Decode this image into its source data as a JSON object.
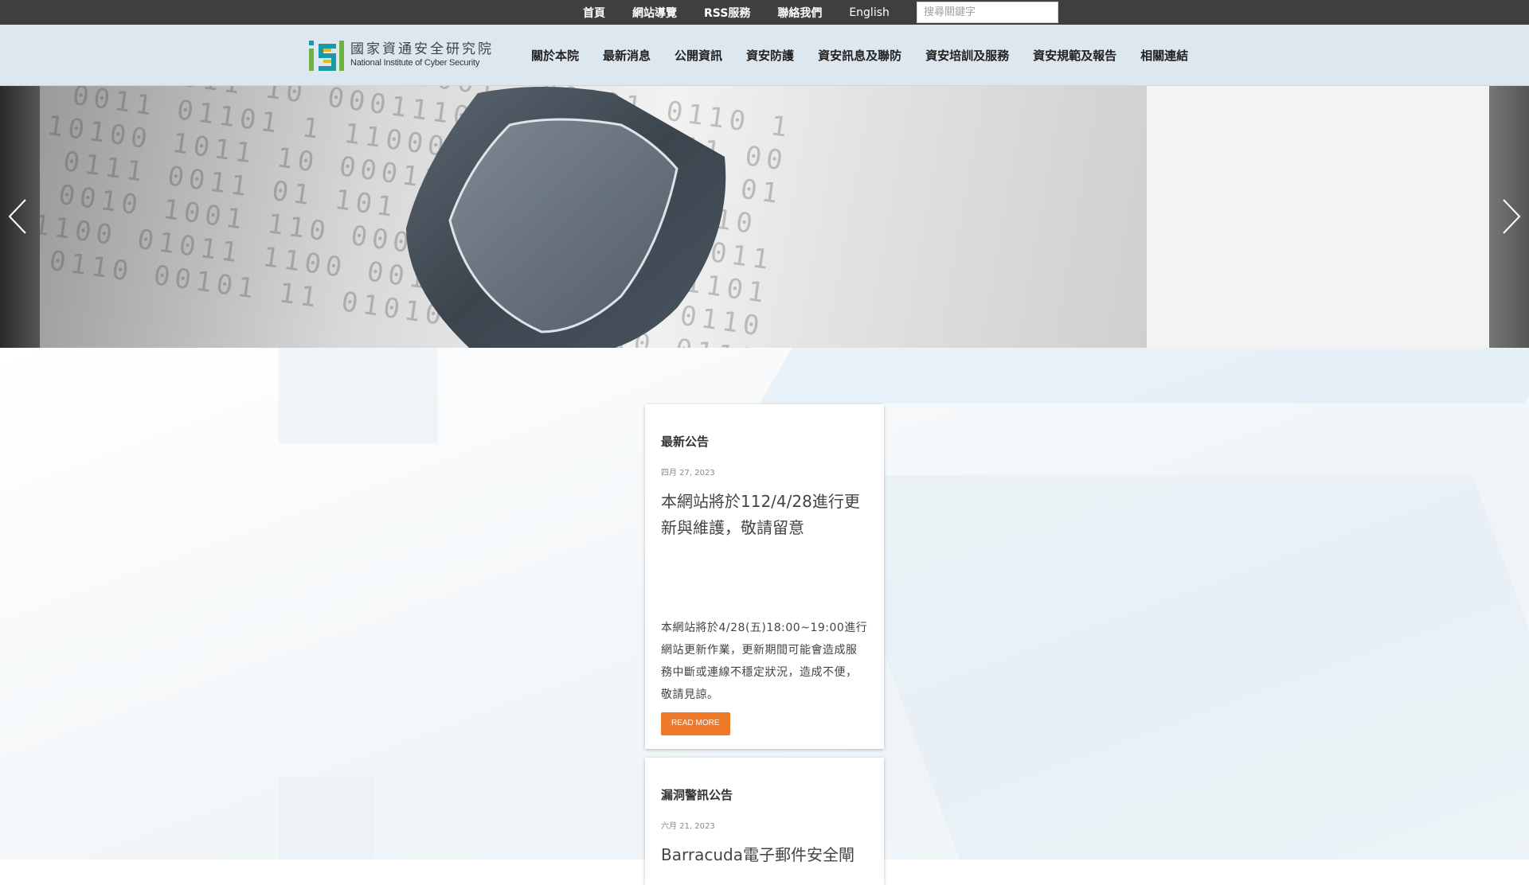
{
  "topbar": {
    "links": [
      "首頁",
      "網站導覽",
      "RSS服務",
      "聯絡我們",
      "English"
    ],
    "search_placeholder": "搜尋關鍵字"
  },
  "header": {
    "logo_zh": "國家資通安全研究院",
    "logo_en": "National Institute of Cyber Security",
    "nav": [
      "關於本院",
      "最新消息",
      "公開資訊",
      "資安防護",
      "資安訊息及聯防",
      "資安培訓及服務",
      "資安規範及報告",
      "相關連結"
    ]
  },
  "hero": {
    "prev_icon": "chevron-left-icon",
    "next_icon": "chevron-right-icon"
  },
  "cards": [
    {
      "category": "最新公告",
      "date": "四月 27, 2023",
      "title": "本網站將於112/4/28進行更新與維護，敬請留意",
      "excerpt": "本網站將於4/28(五)18:00~19:00進行網站更新作業，更新期間可能會造成服務中斷或連線不穩定狀況，造成不便，敬請見諒。",
      "button": "READ MORE"
    },
    {
      "category": "漏洞警訊公告",
      "date": "六月 21, 2023",
      "title": "Barracuda電子郵件安全閘"
    }
  ],
  "colors": {
    "topbar_bg": "#3f3f3f",
    "header_bg": "#dde7ef",
    "button_bg": "#ef7a2a",
    "logo_green": "#6db33f",
    "logo_teal": "#1a9aa5",
    "logo_yellow": "#e8b820"
  }
}
